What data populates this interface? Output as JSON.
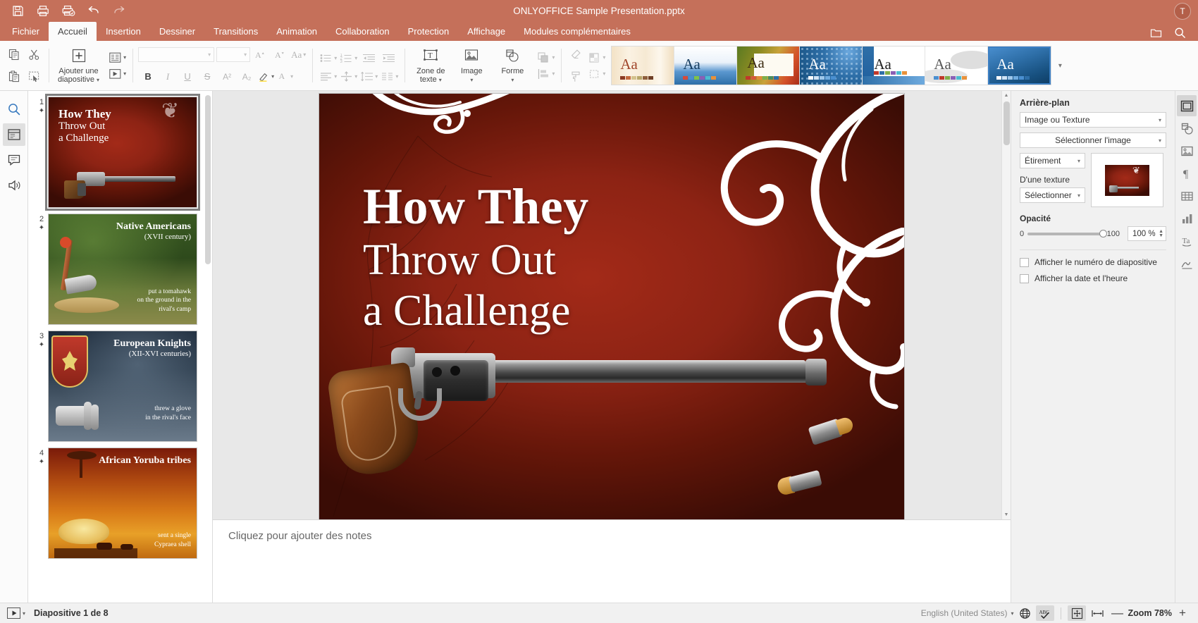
{
  "titlebar": {
    "document_title": "ONLYOFFICE Sample Presentation.pptx",
    "avatar_initial": "T",
    "icons": [
      "save-icon",
      "print-icon",
      "quick-print-icon",
      "undo-icon",
      "redo-icon"
    ]
  },
  "menu": {
    "tabs": [
      {
        "label": "Fichier",
        "active": false
      },
      {
        "label": "Accueil",
        "active": true
      },
      {
        "label": "Insertion",
        "active": false
      },
      {
        "label": "Dessiner",
        "active": false
      },
      {
        "label": "Transitions",
        "active": false
      },
      {
        "label": "Animation",
        "active": false
      },
      {
        "label": "Collaboration",
        "active": false
      },
      {
        "label": "Protection",
        "active": false
      },
      {
        "label": "Affichage",
        "active": false
      },
      {
        "label": "Modules complémentaires",
        "active": false
      }
    ],
    "right_icons": [
      "open-file-location-icon",
      "search-icon"
    ]
  },
  "ribbon": {
    "copy": "Copier",
    "cut": "Couper",
    "paste": "Coller",
    "select_all": "Sélectionner tout",
    "add_slide": "Ajouter une\ndiapositive",
    "add_slide_line1": "Ajouter une",
    "add_slide_line2": "diapositive",
    "layout_tip": "Modifier la disposition",
    "transition_tip": "Transition",
    "font_name": "",
    "font_name_placeholder": "",
    "font_size": "",
    "increase_font": "A",
    "decrease_font": "A",
    "change_case": "Aa",
    "bold": "B",
    "italic": "I",
    "underline": "U",
    "strikethrough": "S",
    "superscript": "A²",
    "subscript": "A₂",
    "text_box": "Zone de",
    "text_box_2": "texte",
    "image": "Image",
    "shape": "Forme",
    "themes": [
      {
        "name": "theme-office",
        "bg": "#f5e7d0",
        "aa_color": "#a0452a",
        "selected": false,
        "swatches": [
          "#8c3b22",
          "#c46a3e",
          "#d3c28d",
          "#b7a76a",
          "#8e5f3d",
          "#6e3f26"
        ]
      },
      {
        "name": "theme-blue-curve",
        "bg": "#2e6fa8",
        "aa_color": "#113a5e",
        "selected": false,
        "swatches": [
          "#d64a3a",
          "#4a8fd0",
          "#7fc24a",
          "#8a5fb5",
          "#4abccf",
          "#e8913a"
        ]
      },
      {
        "name": "theme-stamp",
        "bg": "#8a6a2a",
        "aa_color": "#3a2a10",
        "selected": false,
        "swatches": [
          "#c0392b",
          "#d65a3a",
          "#e08b3a",
          "#7fae4a",
          "#4a8f5f",
          "#2e6fa8"
        ]
      },
      {
        "name": "theme-dots",
        "bg": "#1f5f9e",
        "aa_color": "#ffffff",
        "selected": false,
        "swatches": [
          "#ffffff",
          "#cfe3f5",
          "#9ec7ea",
          "#6fabdf",
          "#4a8fd0",
          "#2e6fa8"
        ]
      },
      {
        "name": "theme-white-wave",
        "bg": "#ffffff",
        "aa_color": "#222222",
        "selected": false,
        "swatches": [
          "#c0392b",
          "#2e6fa8",
          "#7fae4a",
          "#8a5fb5",
          "#4abccf",
          "#e8913a"
        ]
      },
      {
        "name": "theme-grey-cloud",
        "bg": "#ffffff",
        "aa_color": "#555555",
        "selected": false,
        "swatches": [
          "#4a8fd0",
          "#c0392b",
          "#7fae4a",
          "#8a5fb5",
          "#4abccf",
          "#e8913a"
        ]
      },
      {
        "name": "theme-blue-gradient",
        "bg": "#1f5f9e",
        "aa_color": "#ffffff",
        "selected": true,
        "swatches": [
          "#ffffff",
          "#cfe3f5",
          "#9ec7ea",
          "#6fabdf",
          "#4a8fd0",
          "#2e6fa8"
        ]
      }
    ]
  },
  "left_rail": [
    {
      "name": "search-icon",
      "active": false
    },
    {
      "name": "slides-icon",
      "active": true
    },
    {
      "name": "comments-icon",
      "active": false
    },
    {
      "name": "chat-icon",
      "active": false
    }
  ],
  "thumbnails": [
    {
      "number": "1",
      "starred": true,
      "selected": true,
      "title": "How They Throw Out a Challenge",
      "theme": "revolver"
    },
    {
      "number": "2",
      "starred": true,
      "selected": false,
      "title": "Native Americans",
      "subtitle": "(XVII century)",
      "body": "put a tomahawk\non the ground in the\nrival's camp",
      "theme": "forest"
    },
    {
      "number": "3",
      "starred": true,
      "selected": false,
      "title": "European Knights",
      "subtitle": "(XII-XVI centuries)",
      "body": "threw a glove\nin the rival's face",
      "theme": "knight"
    },
    {
      "number": "4",
      "starred": true,
      "selected": false,
      "title": "African Yoruba tribes",
      "body": "sent a single\nCypraea shell",
      "theme": "africa"
    }
  ],
  "slide": {
    "line1": "How They",
    "line2": "Throw Out",
    "line3": "a Challenge"
  },
  "notes": {
    "placeholder": "Cliquez pour ajouter des notes"
  },
  "right_panel": {
    "section_title": "Arrière-plan",
    "fill_type": "Image ou Texture",
    "select_image": "Sélectionner l'image",
    "stretch": "Étirement",
    "from_texture_label": "D'une texture",
    "from_texture_value": "Sélectionner",
    "opacity_label": "Opacité",
    "opacity_min": "0",
    "opacity_max": "100",
    "opacity_value": "100 %",
    "checkbox_slide_number": "Afficher le numéro de diapositive",
    "checkbox_date_time": "Afficher la date et l'heure"
  },
  "far_rail": [
    {
      "name": "slide-settings-icon",
      "active": true
    },
    {
      "name": "shape-settings-icon",
      "active": false
    },
    {
      "name": "image-settings-icon",
      "active": false
    },
    {
      "name": "paragraph-settings-icon",
      "active": false
    },
    {
      "name": "table-settings-icon",
      "active": false
    },
    {
      "name": "chart-settings-icon",
      "active": false
    },
    {
      "name": "text-art-settings-icon",
      "active": false
    },
    {
      "name": "signature-settings-icon",
      "active": false
    }
  ],
  "statusbar": {
    "slide_counter": "Diapositive 1 de 8",
    "language": "English (United States)",
    "spellcheck_icon": "spellcheck-icon",
    "fit_slide_icon": "fit-to-slide-icon",
    "fit_width_icon": "fit-to-width-icon",
    "zoom_out": "—",
    "zoom_label": "Zoom 78%",
    "zoom_in": "+"
  },
  "colors": {
    "accent": "#c5705a",
    "ribbon_bg": "#fbfbfb",
    "panel_bg": "#f1f1f1",
    "selection": "#3b7fc4"
  }
}
